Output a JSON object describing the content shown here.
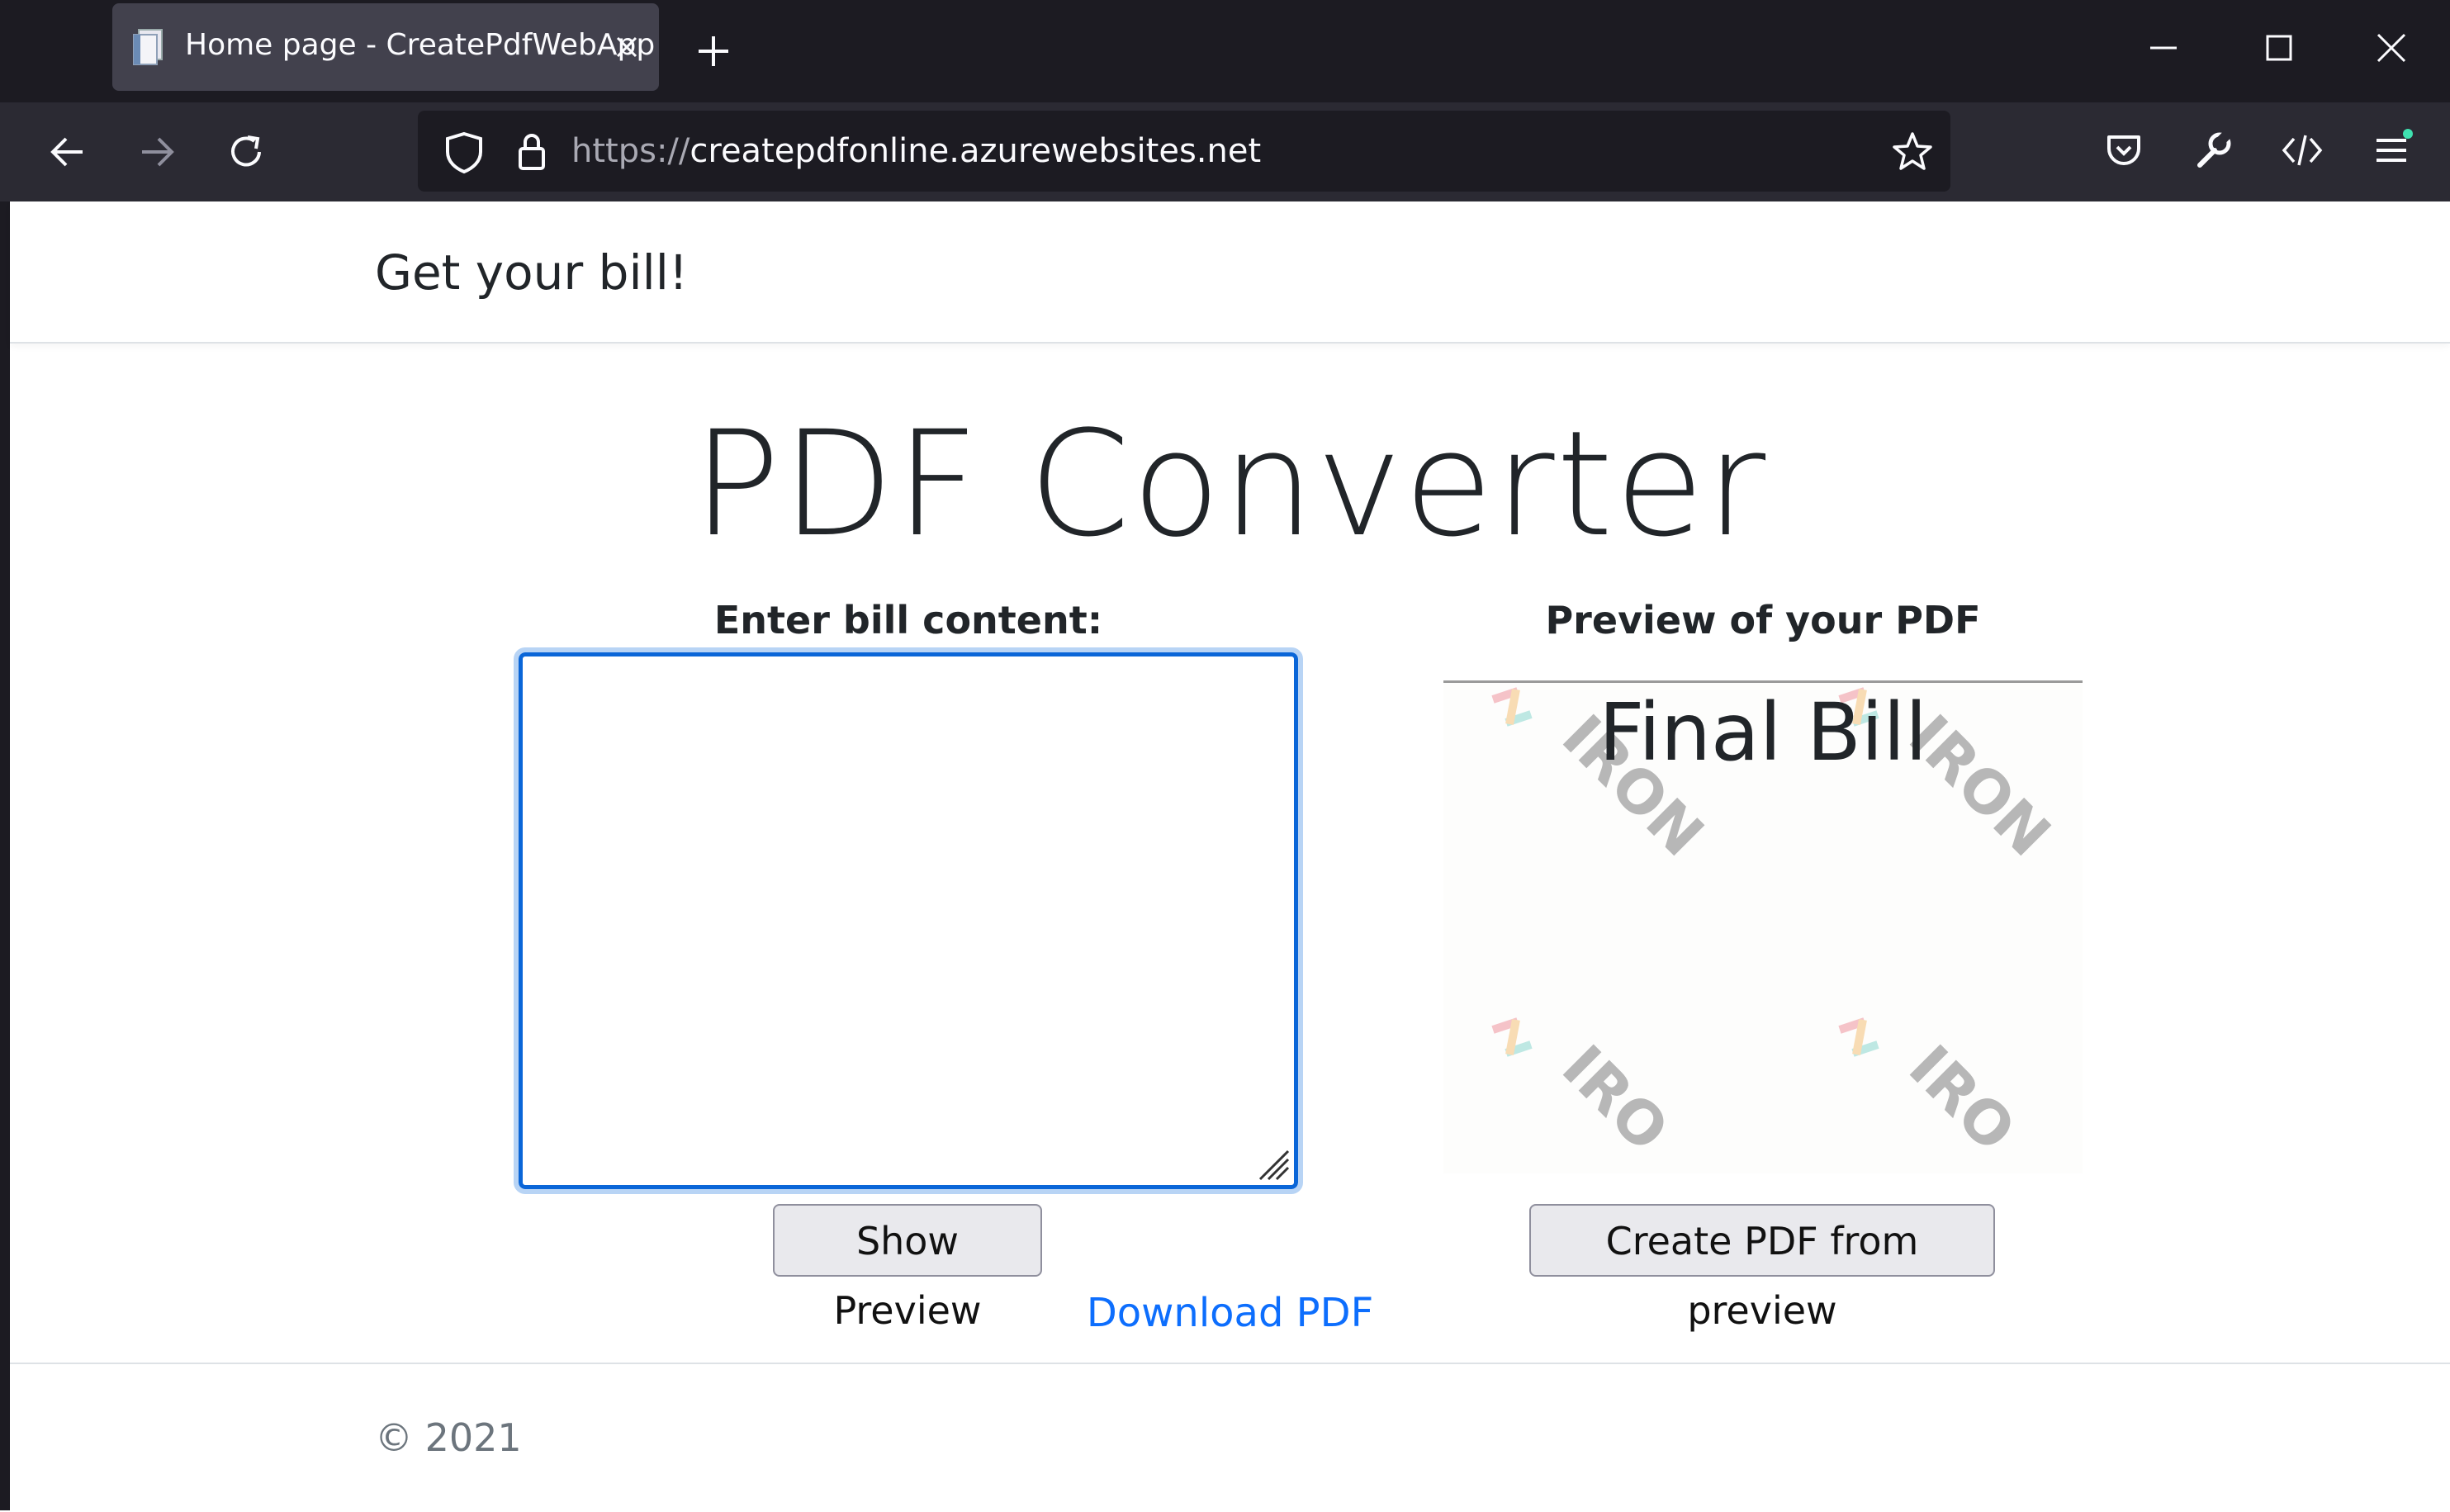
{
  "browser": {
    "tab_title": "Home page - CreatePdfWebApp",
    "url_scheme": "https://",
    "url_host": "createpdfonline.azurewebsites.net",
    "chrome_color": "#1c1b22",
    "toolbar_color": "#2b2a33"
  },
  "icons": {
    "back": "arrow-left-icon",
    "forward": "arrow-right-icon",
    "reload": "reload-icon",
    "shield": "shield-icon",
    "lock": "lock-icon",
    "bookmark": "star-icon",
    "pocket": "pocket-icon",
    "tools": "wrench-icon",
    "devtools": "code-icon",
    "menu": "hamburger-menu-icon"
  },
  "header": {
    "brand": "Get your bill!"
  },
  "main": {
    "title": "PDF Converter",
    "input_label": "Enter bill content:",
    "textarea_value": "",
    "preview_label": "Preview of your PDF",
    "preview_heading": "Final Bill",
    "show_preview_button": "Show Preview",
    "create_pdf_button": "Create PDF from preview",
    "download_link": "Download PDF",
    "link_color": "#0d6efd",
    "focus_color": "#0a66d8"
  },
  "footer": {
    "copyright": "© 2021"
  }
}
